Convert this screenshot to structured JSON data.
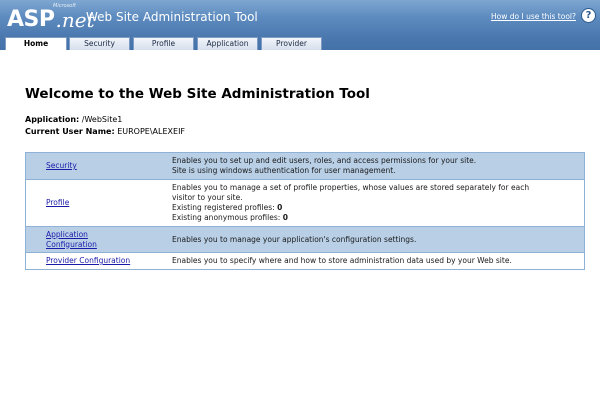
{
  "header": {
    "logo_asp": "ASP",
    "logo_net": ".net",
    "logo_ms": "Microsoft",
    "title": "Web Site Administration Tool",
    "help_link": "How do I use this tool?",
    "help_icon_glyph": "?",
    "help_icon": "question-circle-icon"
  },
  "tabs": [
    {
      "label": "Home",
      "active": true
    },
    {
      "label": "Security",
      "active": false
    },
    {
      "label": "Profile",
      "active": false
    },
    {
      "label": "Application",
      "active": false
    },
    {
      "label": "Provider",
      "active": false
    }
  ],
  "main": {
    "title": "Welcome to the Web Site Administration Tool",
    "application_label": "Application:",
    "application_value": "/WebSite1",
    "user_label": "Current User Name:",
    "user_value": "EUROPE\\ALEXEIF"
  },
  "features": [
    {
      "link": "Security",
      "lines": [
        "Enables you to set up and edit users, roles, and access permissions for your site.",
        "Site is using windows authentication for user management."
      ]
    },
    {
      "link": "Profile",
      "lines": [
        "Enables you to manage a set of profile properties, whose values are stored separately for each",
        "visitor to your site."
      ],
      "registered_label": "Existing registered profiles:",
      "registered_count": "0",
      "anonymous_label": "Existing anonymous profiles:",
      "anonymous_count": "0"
    },
    {
      "link_line1": "Application",
      "link_line2": "Configuration",
      "lines": [
        "Enables you to manage your application's configuration settings."
      ]
    },
    {
      "link": "Provider Configuration",
      "lines": [
        "Enables you to specify where and how to store administration data used by your Web site."
      ]
    }
  ],
  "colors": {
    "header_blue": "#5e8cc0",
    "row_shade": "#b8cfe6",
    "link": "#1a1aa8"
  }
}
